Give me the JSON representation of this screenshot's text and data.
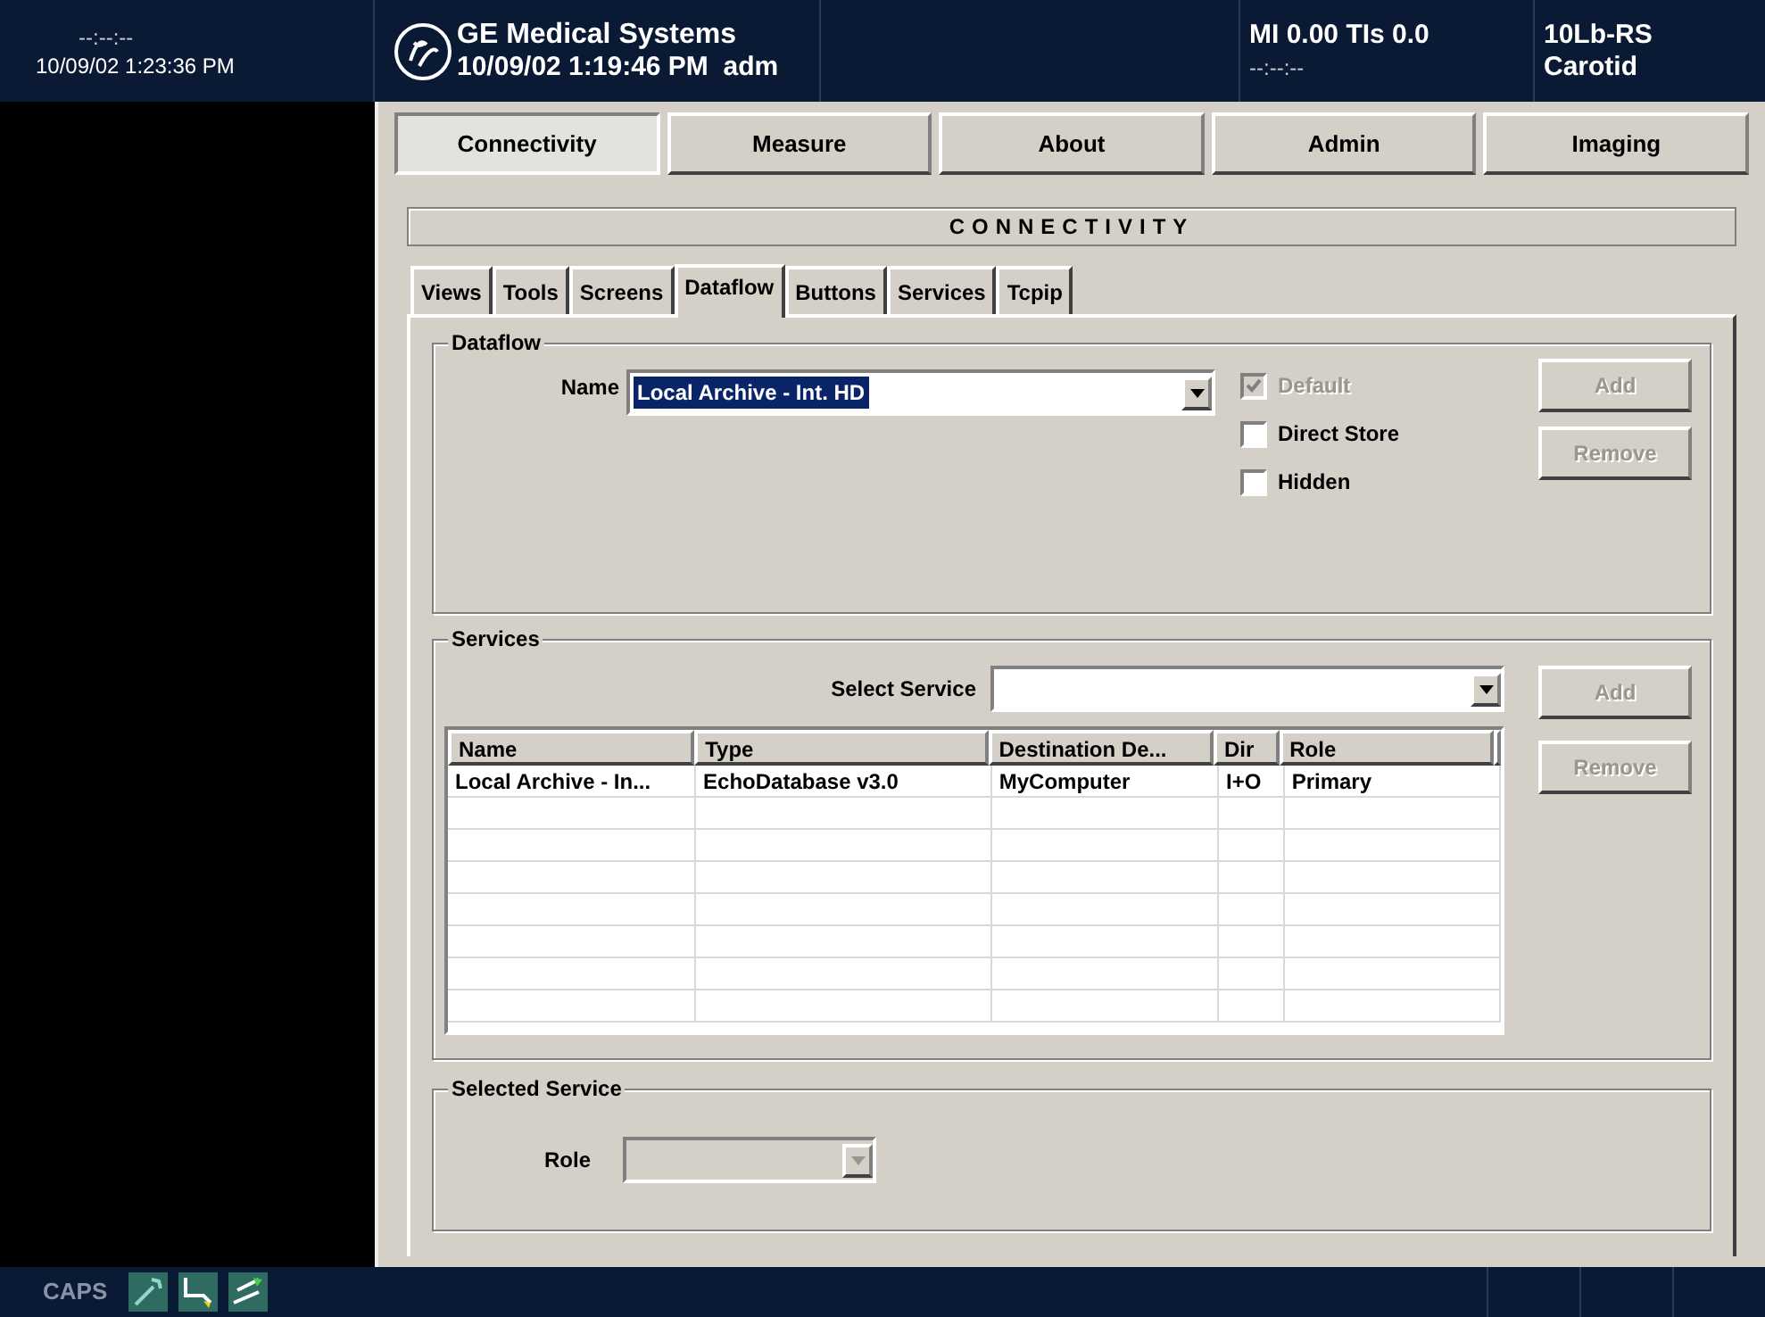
{
  "top_bar": {
    "clock": "--:--:--",
    "date": "10/09/02 1:23:36 PM",
    "title": "GE Medical Systems",
    "session": "10/09/02 1:19:46 PM  adm",
    "indices": "MI 0.00 TIs 0.0",
    "timer": "--:--:--",
    "probe": "10Lb-RS",
    "preset": "Carotid"
  },
  "main_tabs": [
    {
      "label": "Connectivity",
      "selected": true
    },
    {
      "label": "Measure",
      "selected": false
    },
    {
      "label": "About",
      "selected": false
    },
    {
      "label": "Admin",
      "selected": false
    },
    {
      "label": "Imaging",
      "selected": false
    }
  ],
  "section_title": "CONNECTIVITY",
  "sub_tabs": [
    {
      "label": "Views",
      "selected": false
    },
    {
      "label": "Tools",
      "selected": false
    },
    {
      "label": "Screens",
      "selected": false
    },
    {
      "label": "Dataflow",
      "selected": true
    },
    {
      "label": "Buttons",
      "selected": false
    },
    {
      "label": "Services",
      "selected": false
    },
    {
      "label": "Tcpip",
      "selected": false
    }
  ],
  "dataflow": {
    "legend": "Dataflow",
    "name_label": "Name",
    "name_value": "Local Archive - Int. HD",
    "checkboxes": [
      {
        "label": "Default",
        "checked": true,
        "disabled": true
      },
      {
        "label": "Direct Store",
        "checked": false,
        "disabled": false
      },
      {
        "label": "Hidden",
        "checked": false,
        "disabled": false
      }
    ],
    "buttons": [
      {
        "label": "Add",
        "disabled": true
      },
      {
        "label": "Remove",
        "disabled": true
      }
    ]
  },
  "services": {
    "legend": "Services",
    "select_label": "Select Service",
    "buttons": [
      {
        "label": "Add",
        "disabled": true
      },
      {
        "label": "Remove",
        "disabled": true
      }
    ],
    "table": {
      "columns": [
        "Name",
        "Type",
        "Destination De...",
        "Dir",
        "Role"
      ],
      "rows": [
        [
          "Local Archive - In...",
          "EchoDatabase v3.0",
          "MyComputer",
          "I+O",
          "Primary"
        ]
      ]
    }
  },
  "selected_service": {
    "legend": "Selected Service",
    "role_label": "Role",
    "role_disabled": true
  },
  "bottom_bar": {
    "caps": "CAPS"
  }
}
